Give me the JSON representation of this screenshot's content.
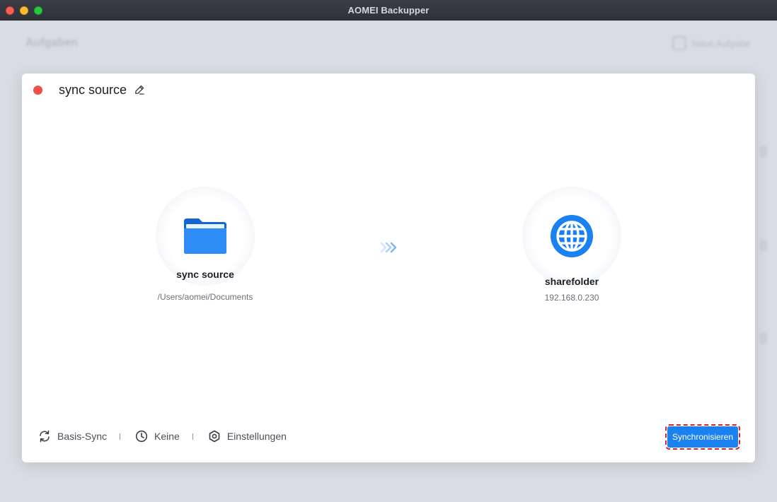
{
  "window": {
    "title": "AOMEI Backupper"
  },
  "background": {
    "heading": "Aufgaben",
    "new_task": "Neue Aufgabe"
  },
  "dialog": {
    "task_name": "sync source",
    "source": {
      "name": "sync source",
      "path": "/Users/aomei/Documents",
      "icon": "folder-icon"
    },
    "destination": {
      "name": "sharefolder",
      "address": "192.168.0.230",
      "icon": "globe-icon"
    },
    "options": [
      {
        "label": "Basis-Sync",
        "icon": "sync-icon"
      },
      {
        "label": "Keine",
        "icon": "clock-icon"
      },
      {
        "label": "Einstellungen",
        "icon": "gear-icon"
      }
    ],
    "primary_button": "Synchronisieren"
  },
  "colors": {
    "accent": "#1a82f0",
    "close_dot": "#ef5148",
    "highlight_border": "#d6202b"
  }
}
